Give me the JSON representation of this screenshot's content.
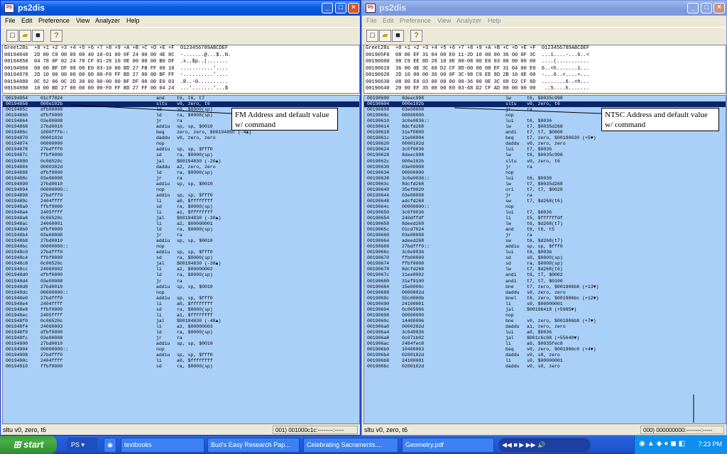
{
  "left_window": {
    "title": "ps2dis",
    "menu": [
      "File",
      "Edit",
      "Preference",
      "View",
      "Analyzer",
      "Help"
    ],
    "hex_lines": [
      "Greet28s  +0 +1 +2 +3 +4 +5 +6 +7 +8 +9 +A +B +C +D +E +F  0123456789ABCDEF",
      "00194840  2D 80 C0 00 09 00 40 10-01 00 0F 24 00 00 4E 8C  -.......@...$..N.",
      "00194850  04 78 0F 02 24 70 CF 01-28 10 0E 00 00 00 B0 DF  .x..$p..(.......",
      "00194860  00 00 BF DF 08 00 E0 03-10 00 BD 27 FB FF 00 10  ...........'....",
      "00194870  2D 10 00 00 00 00 00 00-F0 FF BD 27 00 00 BF FF  -..........'....",
      "00194880  0C 52 06 0C 2D 30 00 00-00 00 BF DF 08 00 E0 03  .R..-0..........",
      "00194890  10 00 BD 27 00 00 00 00-F0 FF BD 27 FF 00 04 24  ...'.......'...$"
    ],
    "code_rows": [
      [
        "00194854",
        "01cf7024",
        "and",
        "t6, t6, t7"
      ],
      [
        "00194858",
        "000e102b",
        "sltu",
        "v0, zero, t6"
      ],
      [
        "0019485c",
        "dfb00000",
        "ld",
        "s0, $0000(sp)"
      ],
      [
        "00194860",
        "dfbf0000",
        "ld",
        "ra, $0008(sp)"
      ],
      [
        "00194864",
        "03e00008",
        "jr",
        "ra"
      ],
      [
        "00194868",
        "27bd0010",
        "addiu",
        "sp, sp, $0010"
      ],
      [
        "0019486c",
        "1000fffb::",
        "beq",
        "zero, zero, $0019485c (-4▲)"
      ],
      [
        "00194870",
        "0000102d",
        "daddu",
        "v0, zero, zero"
      ],
      [
        "00194874",
        "00000000",
        "nop",
        ""
      ],
      [
        "00194878",
        "27bdfff0",
        "addiu",
        "sp, sp, $fff0"
      ],
      [
        "0019487c",
        "ffbf0000",
        "sd",
        "ra, $0000(sp)"
      ],
      [
        "00194880",
        "0c06520c",
        "jal",
        "$00194830 (-20▲)"
      ],
      [
        "00194884",
        "0000302d",
        "daddu",
        "a2, zero, zero"
      ],
      [
        "00194888",
        "dfbf0000",
        "ld",
        "ra, $0000(sp)"
      ],
      [
        "0019488c",
        "03e00008",
        "jr",
        "ra"
      ],
      [
        "00194890",
        "27bd0010",
        "addiu",
        "sp, sp, $0010"
      ],
      [
        "00194894",
        "00000000::",
        "nop",
        ""
      ],
      [
        "00194898",
        "27bdfff0",
        "addiu",
        "sp, sp, $fff0"
      ],
      [
        "0019489c",
        "2404ffff",
        "li",
        "a0, $ffffffff"
      ],
      [
        "001948a0",
        "ffbf0000",
        "sd",
        "ra, $0000(sp)"
      ],
      [
        "001948a4",
        "2405ffff",
        "li",
        "a1, $ffffffff"
      ],
      [
        "001948a8",
        "0c06520c",
        "jal",
        "$00194830 (-30▲)"
      ],
      [
        "001948ac",
        "24060001",
        "li",
        "a2, $00000001"
      ],
      [
        "001948b0",
        "dfbf0000",
        "ld",
        "ra, $0000(sp)"
      ],
      [
        "001948b4",
        "03e00008",
        "jr",
        "ra"
      ],
      [
        "001948b8",
        "27bd0010",
        "addiu",
        "sp, sp, $0010"
      ],
      [
        "001948bc",
        "00000000::",
        "nop",
        ""
      ],
      [
        "001948c0",
        "27bdfff0",
        "addiu",
        "sp, sp, $fff0"
      ],
      [
        "001948c4",
        "ffbf0000",
        "sd",
        "ra, $0000(sp)"
      ],
      [
        "001948c8",
        "0c06520c",
        "jal",
        "$00194830 (-38▲)"
      ],
      [
        "001948cc",
        "24060002",
        "li",
        "a2, $00000002"
      ],
      [
        "001948d0",
        "dfbf0000",
        "ld",
        "ra, $0000(sp)"
      ],
      [
        "001948d4",
        "03e00008",
        "jr",
        "ra"
      ],
      [
        "001948d8",
        "27bd0010",
        "addiu",
        "sp, sp, $0010"
      ],
      [
        "001948dc",
        "00000000::",
        "nop",
        ""
      ],
      [
        "001948e0",
        "27bdfff0",
        "addiu",
        "sp, sp, $fff0"
      ],
      [
        "001948e4",
        "2404ffff",
        "li",
        "a0, $ffffffff"
      ],
      [
        "001948e8",
        "ffbf0000",
        "sd",
        "ra, $0000(sp)"
      ],
      [
        "001948ec",
        "2405ffff",
        "li",
        "a1, $ffffffff"
      ],
      [
        "001948f0",
        "0c06520c",
        "jal",
        "$00194830 (-48▲)"
      ],
      [
        "001948f4",
        "24060003",
        "li",
        "a2, $00000003"
      ],
      [
        "001948f8",
        "dfbf0000",
        "ld",
        "ra, $0000(sp)"
      ],
      [
        "001948fc",
        "03e00008",
        "jr",
        "ra"
      ],
      [
        "00194900",
        "27bd0010",
        "addiu",
        "sp, sp, $0010"
      ],
      [
        "00194904",
        "00000000::",
        "nop",
        ""
      ],
      [
        "00194908",
        "27bdfff0",
        "addiu",
        "sp, sp, $fff0"
      ],
      [
        "0019490c",
        "2404ffff",
        "li",
        "a0, $ffffffff"
      ],
      [
        "00194910",
        "ffbf0000",
        "sd",
        "ra, $0000(sp)"
      ]
    ],
    "selected_row": 1,
    "status_left": "sltu v0, zero, t6",
    "status_right": "001) 001000c1c:--------:-----",
    "annotation": "FM Address and default value w/ command"
  },
  "right_window": {
    "title": "ps2dis",
    "menu": [
      "File",
      "Edit",
      "Preference",
      "View",
      "Analyzer",
      "Help"
    ],
    "hex_lines": [
      "Greet28s  +0 +1 +2 +3 +4 +5 +6 +7 +8 +9 +A +B +C +D +E +F  0123456789ABCDEF",
      "001905F0  08 00 EF 31 04 00 E0 11-2D 10 00 00 36 00 0F 3C  ...1....-...6..<",
      "00190600  98 C9 EE 8D 28 10 0E 00-08 00 E0 03 00 00 00 00  ....(...........",
      "00190610  36 00 0E 3C 68 D2 CF 8D-00 00 08 EF 31 04 00 E0  6..<h.......1...",
      "00190620  2D 10 00 00 36 00 0F 3C-98 C9 EE 8D 2B 10 0E 00  -...6..<....+...",
      "00190630  08 00 E0 03 00 00 00 00-36 00 0E 3C 68 D2 CF 8D  ........6..<h...",
      "00190640  20 00 EF 35 08 00 E0 03-68 D2 CF AD 00 00 00 00   ..5....h......."
    ],
    "code_rows": [
      [
        "00190600",
        "8deec998",
        "lw",
        "t6, $0035c998"
      ],
      [
        "00190604",
        "000e102b",
        "sltu",
        "v0, zero, t6"
      ],
      [
        "00190608",
        "03e00008",
        "jr",
        "ra"
      ],
      [
        "0019060c",
        "00000000",
        "nop",
        ""
      ],
      [
        "00190610",
        "3c0e0036::",
        "lui",
        "t6, $0036"
      ],
      [
        "00190614",
        "8dcfd268",
        "lw",
        "t7, $0035d268"
      ],
      [
        "00190618",
        "31ef0800",
        "andi",
        "t7, t7, $0800"
      ],
      [
        "0019061c",
        "11e00004",
        "beq",
        "t7, zero, $00190630 (+5▼)"
      ],
      [
        "00190620",
        "0000102d",
        "daddu",
        "v0, zero, zero"
      ],
      [
        "00190624",
        "3c0f0036",
        "lui",
        "t7, $0036"
      ],
      [
        "00190628",
        "8deec998",
        "lw",
        "t6, $0035c998"
      ],
      [
        "0019062c",
        "000e102b",
        "sltu",
        "v0, zero, t6"
      ],
      [
        "00190630",
        "03e00008",
        "jr",
        "ra"
      ],
      [
        "00190634",
        "00000000",
        "nop",
        ""
      ],
      [
        "00190638",
        "3c0e0036::",
        "lui",
        "t6, $0036"
      ],
      [
        "0019063c",
        "8dcfd268",
        "lw",
        "t7, $0035d268"
      ],
      [
        "00190640",
        "35ef0020",
        "ori",
        "t7, t7, $0020"
      ],
      [
        "00190644",
        "03e00008",
        "jr",
        "ra"
      ],
      [
        "00190648",
        "adcfd268",
        "sw",
        "t7, $d268(t6)"
      ],
      [
        "0019064c",
        "00000000::",
        "nop",
        ""
      ],
      [
        "00190650",
        "3c0f0036",
        "lui",
        "t7, $0036"
      ],
      [
        "00190654",
        "240dffdf",
        "li",
        "t5, $ffffffdf"
      ],
      [
        "00190658",
        "8deed268",
        "lw",
        "t6, $d268(t7)"
      ],
      [
        "0019065c",
        "01cd7024",
        "and",
        "t6, t6, t5"
      ],
      [
        "00190660",
        "03e00008",
        "jr",
        "ra"
      ],
      [
        "00190664",
        "adeed268",
        "sw",
        "t6, $d268(t7)"
      ],
      [
        "00190668",
        "27bdfff0::",
        "addiu",
        "sp, sp, $fff0"
      ],
      [
        "0019066c",
        "3c0e0036",
        "lui",
        "t6, $0036"
      ],
      [
        "00190670",
        "ffb00000",
        "sd",
        "s0, $0000(sp)"
      ],
      [
        "00190674",
        "ffbf0008",
        "sd",
        "ra, $0008(sp)"
      ],
      [
        "00190678",
        "8dcfd268",
        "lw",
        "t7, $d268(t6)"
      ],
      [
        "0019067c",
        "31ee0002",
        "andi",
        "t6, t7, $0002"
      ],
      [
        "00190680",
        "31ef0100",
        "andi",
        "t7, t7, $0100"
      ],
      [
        "00190684",
        "15e0000c",
        "bne",
        "t7, zero, $001906b8 (+13▼)"
      ],
      [
        "00190688",
        "0000802d",
        "daddu",
        "s0, zero, zero"
      ],
      [
        "0019068c",
        "55c0000b",
        "bnel",
        "t6, zero, $001906bc (+12▼)"
      ],
      [
        "00190690",
        "24100001",
        "li",
        "s0, $00000001"
      ],
      [
        "00190694",
        "0c065906",
        "jal",
        "$00196418 (+5985▼)"
      ],
      [
        "00190698",
        "00000000",
        "nop",
        ""
      ],
      [
        "0019069c",
        "14400006",
        "bne",
        "v0, zero, $001906b8 (+7▼)"
      ],
      [
        "001906a0",
        "0000282d",
        "daddu",
        "a1, zero, zero"
      ],
      [
        "001906a4",
        "3c040036",
        "lui",
        "a0, $0036"
      ],
      [
        "001906a8",
        "0c071b02",
        "jal",
        "$001c6c08 (+55640▼)"
      ],
      [
        "001906ac",
        "2484fec8",
        "li",
        "a0, $0035fec8"
      ],
      [
        "001906b0",
        "10400003",
        "beq",
        "v0, zero, $001906c0 (+4▼)"
      ],
      [
        "001906b4",
        "0200102d",
        "daddu",
        "v0, s0, zero"
      ],
      [
        "001906b8",
        "24100001",
        "li",
        "s0, $00000001"
      ],
      [
        "001906bc",
        "0200102d",
        "daddu",
        "v0, s0, zero"
      ]
    ],
    "selected_row": 1,
    "status_left": "sltu v0, zero, t6",
    "status_right": "000) 000000000:--------:-----",
    "annotation": "NTSC Address and default value w/ command"
  },
  "taskbar": {
    "start_label": "start",
    "items": [
      "textbooks",
      "Bud's Easy Research Pap...",
      "Celebrating Sacraments....",
      "Geometry.pdf"
    ],
    "clock": "7:23 PM"
  }
}
